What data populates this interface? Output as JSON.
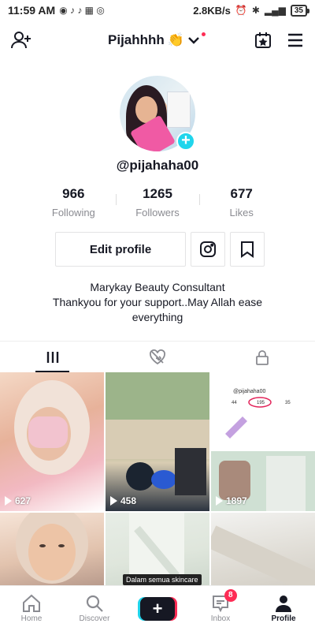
{
  "status_bar": {
    "time": "11:59 AM",
    "network_speed": "2.8KB/s",
    "battery": "35",
    "signal": "4G"
  },
  "header": {
    "title": "Pijahhhh",
    "title_emoji": "👏",
    "icons": [
      "add-user-icon",
      "calendar-star-icon",
      "menu-icon"
    ]
  },
  "profile": {
    "username": "@pijahaha00",
    "stats": [
      {
        "value": "966",
        "label": "Following"
      },
      {
        "value": "1265",
        "label": "Followers"
      },
      {
        "value": "677",
        "label": "Likes"
      }
    ],
    "edit_label": "Edit profile",
    "bio_lines": [
      "Marykay Beauty Consultant",
      "Thankyou for your support..May Allah ease everything"
    ]
  },
  "tabs": [
    "videos-grid-icon",
    "liked-hidden-icon",
    "private-lock-icon"
  ],
  "videos": [
    {
      "views": "627"
    },
    {
      "views": "458"
    },
    {
      "views": "1897"
    },
    {
      "views": ""
    },
    {
      "views": "",
      "caption": "Dalam semua skincare"
    },
    {
      "views": ""
    }
  ],
  "bottom_nav": {
    "home": "Home",
    "discover": "Discover",
    "inbox": "Inbox",
    "inbox_badge": "8",
    "profile": "Profile"
  },
  "colors": {
    "accent_red": "#fe2c55",
    "accent_cyan": "#20d5ec",
    "text": "#161823",
    "muted": "#8a8b91"
  }
}
